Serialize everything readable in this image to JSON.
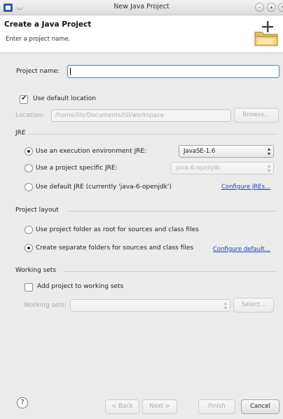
{
  "window": {
    "title": "New Java Project"
  },
  "header": {
    "title": "Create a Java Project",
    "subtitle": "Enter a project name.",
    "banner_icon": "new-java-project-wizard-banner-icon"
  },
  "project_name": {
    "label": "Project name:",
    "value": ""
  },
  "location": {
    "use_default_label": "Use default location",
    "use_default_checked": true,
    "label": "Location:",
    "value": "/home/lile/Documents/ISI/workspace",
    "browse_label": "Browse..."
  },
  "jre": {
    "group_title": "JRE",
    "option_execution_env": "Use an execution environment JRE:",
    "execution_env_value": "JavaSE-1.6",
    "option_project_specific": "Use a project specific JRE:",
    "project_specific_value": "java-6-openjdk",
    "option_default": "Use default JRE (currently 'java-6-openjdk')",
    "selected": "execution_env",
    "configure_link": "Configure JREs..."
  },
  "project_layout": {
    "group_title": "Project layout",
    "option_single_folder": "Use project folder as root for sources and class files",
    "option_separate_folders": "Create separate folders for sources and class files",
    "selected": "separate_folders",
    "configure_link": "Configure default..."
  },
  "working_sets": {
    "group_title": "Working sets",
    "add_label": "Add project to working sets",
    "add_checked": false,
    "sets_label": "Working sets:",
    "sets_value": "",
    "select_label": "Select..."
  },
  "footer": {
    "help_glyph": "?",
    "back_label": "< Back",
    "next_label": "Next >",
    "finish_label": "Finish",
    "cancel_label": "Cancel"
  }
}
